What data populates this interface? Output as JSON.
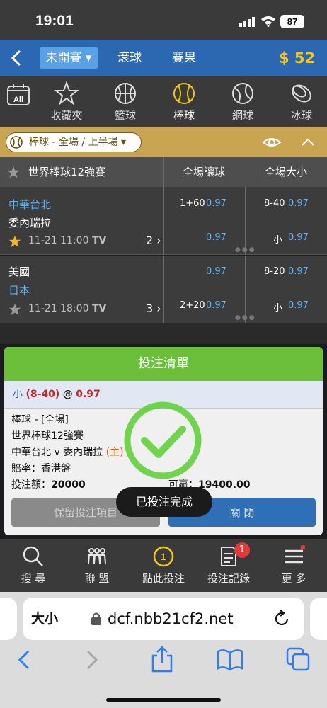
{
  "status": {
    "time": "19:01",
    "battery": "87"
  },
  "header": {
    "tabs": [
      {
        "label": "未開賽 ▾"
      },
      {
        "label": "滾球"
      },
      {
        "label": "賽果"
      }
    ],
    "balance": "$ 52 ▾"
  },
  "sports": [
    {
      "label": "",
      "icon": "all-icon"
    },
    {
      "label": "收藏夾",
      "icon": "star-icon"
    },
    {
      "label": "籃球",
      "icon": "basketball-icon"
    },
    {
      "label": "棒球",
      "icon": "baseball-icon"
    },
    {
      "label": "網球",
      "icon": "tennis-icon"
    },
    {
      "label": "冰球",
      "icon": "hockey-icon"
    }
  ],
  "all_label": "All",
  "filter": {
    "label": "棒球 - 全場 / 上半場 ▾"
  },
  "table": {
    "league": "世界棒球12強賽",
    "col_handicap": "全場讓球",
    "col_total": "全場大小",
    "matches": [
      {
        "home": "中華台北",
        "away": "委內瑞拉",
        "datetime": "11-21 11:00",
        "tv": "TV",
        "more": "2 ›",
        "line1_hcp": "1+60",
        "line1_hcp_odds": "0.97",
        "line1_total": "8-40",
        "line1_total_odds": "0.97",
        "line2_hcp_odds": "0.97",
        "line2_total": "小",
        "line2_total_odds": "0.97"
      },
      {
        "home": "美國",
        "away": "日本",
        "datetime": "11-21 18:00",
        "tv": "TV",
        "more": "3 ›",
        "line1_hcp_odds": "0.97",
        "line1_total": "8-20",
        "line1_total_odds": "0.97",
        "line2_hcp": "2+20",
        "line2_hcp_odds": "0.97",
        "line2_total": "小",
        "line2_total_odds": "0.97"
      }
    ]
  },
  "slip": {
    "title": "投注清單",
    "sel_side": "小",
    "sel_line": "(8-40)",
    "sel_at": "@",
    "sel_odds": "0.97",
    "sport_line": "棒球 - [全場]",
    "league": "世界棒球12強賽",
    "match": "中華台北 v 委內瑞拉",
    "home_tag": "(主)",
    "odds_type": "賠率：香港盤",
    "stake_label": "投注額：",
    "stake": "20000",
    "win_label": "可贏：",
    "win": "19400.00",
    "keep_btn": "保留投注項目",
    "close_btn": "關 閉"
  },
  "toast": "已投注完成",
  "bottom_nav": [
    {
      "label": "搜 尋",
      "icon": "search-icon"
    },
    {
      "label": "聯 盟",
      "icon": "league-icon"
    },
    {
      "label": "點此投注",
      "icon": "bet-count-icon",
      "badge": "1"
    },
    {
      "label": "投注記錄",
      "icon": "bet-record-icon",
      "badge": "1"
    },
    {
      "label": "更 多",
      "icon": "menu-icon"
    }
  ],
  "safari": {
    "aa": "大小",
    "url": "dcf.nbb21cf2.net"
  },
  "colors": {
    "header_blue": "#2c67b2",
    "gold": "#c9a552",
    "green": "#6bbf3a",
    "link_blue": "#5fb1f0",
    "balance": "#f5c518"
  }
}
